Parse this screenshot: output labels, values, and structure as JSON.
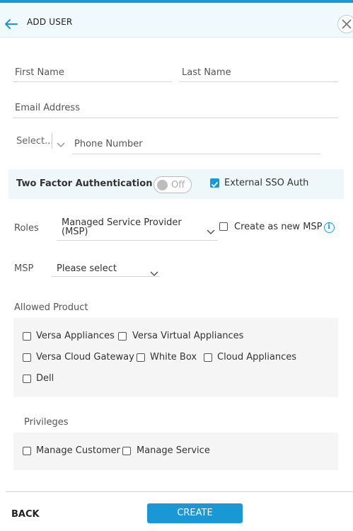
{
  "header": {
    "title": "ADD USER"
  },
  "form": {
    "first_name_placeholder": "First Name",
    "last_name_placeholder": "Last Name",
    "email_placeholder": "Email Address",
    "country_code_placeholder": "Select...",
    "phone_placeholder": "Phone Number"
  },
  "two_factor": {
    "label": "Two Factor Authentication",
    "toggle_state": "Off",
    "sso_label": "External SSO Auth",
    "sso_checked": true
  },
  "roles": {
    "label": "Roles",
    "selected_line1": "Managed Service Provider",
    "selected_line2": "(MSP)",
    "create_msp_label": "Create as new MSP"
  },
  "msp": {
    "label": "MSP",
    "selected": "Please select"
  },
  "allowed_product": {
    "label": "Allowed Product",
    "items": [
      "Versa Appliances",
      "Versa Virtual Appliances",
      "Versa Cloud Gateway",
      "White Box",
      "Cloud Appliances",
      "Dell"
    ]
  },
  "privileges": {
    "label": "Privileges",
    "items": [
      "Manage Customer",
      "Manage Service"
    ]
  },
  "footer": {
    "back_label": "BACK",
    "create_label": "CREATE"
  },
  "colors": {
    "accent": "#1a97d5",
    "header_bg": "#f0fafd"
  }
}
